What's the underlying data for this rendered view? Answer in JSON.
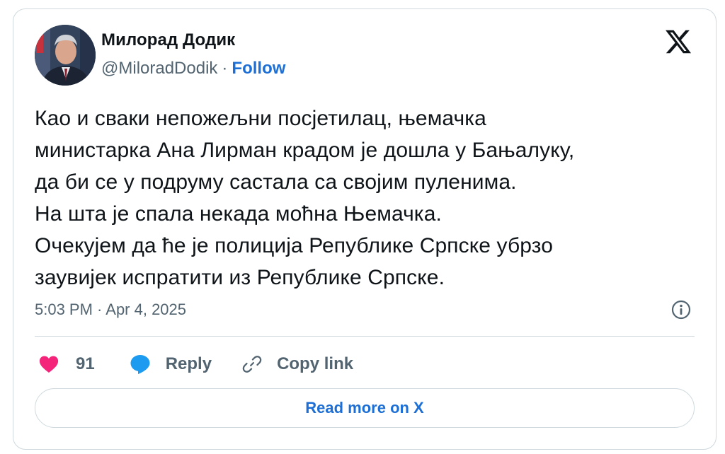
{
  "author": {
    "name": "Милорад Додик",
    "handle": "@MiloradDodik",
    "separator": "·",
    "follow_label": "Follow"
  },
  "tweet": {
    "text": "Као и сваки непожељни посјетилац, њемачка\nминистарка Ана Лирман крадом је дошла у Бањалуку,\nда би се у подруму састала са својим пуленима.\nНа шта је спала некада моћна Њемачка.\nОчекујем да ће је полиција Републике Српске убрзо\nзаувијек испратити из Републике Српске.",
    "timestamp": "5:03 PM · Apr 4, 2025"
  },
  "actions": {
    "like_count": "91",
    "reply_label": "Reply",
    "copy_link_label": "Copy link"
  },
  "read_more_label": "Read more on X",
  "icons": {
    "logo": "x-logo-icon",
    "info": "info-icon",
    "like": "heart-icon",
    "reply": "speech-bubble-icon",
    "copy": "link-icon"
  },
  "colors": {
    "link": "#1d6fd6",
    "heart": "#f4247b",
    "reply": "#1d9bf0",
    "secondary_text": "#536471",
    "border": "#cfd9de"
  }
}
